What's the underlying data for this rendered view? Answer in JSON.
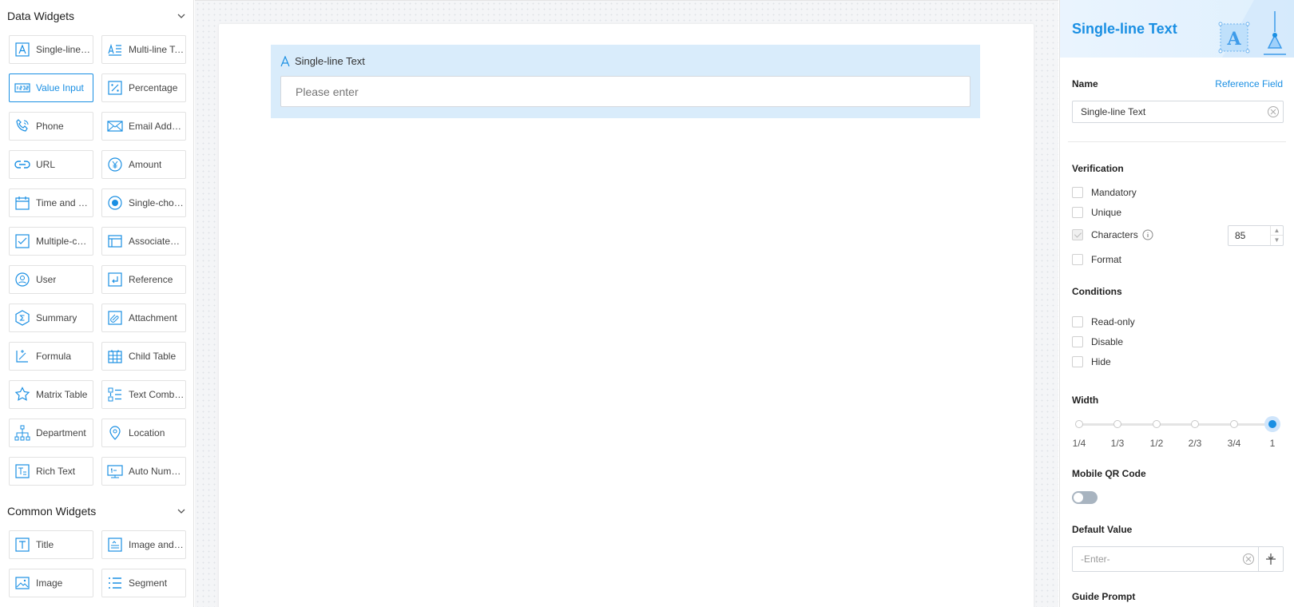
{
  "left_panel": {
    "data_widgets_title": "Data Widgets",
    "data_widgets": [
      {
        "label": "Single-line Text",
        "icon": "text-a-icon"
      },
      {
        "label": "Multi-line Text",
        "icon": "multiline-text-icon"
      },
      {
        "label": "Value Input",
        "icon": "value-input-icon",
        "active": true
      },
      {
        "label": "Percentage",
        "icon": "percentage-icon"
      },
      {
        "label": "Phone",
        "icon": "phone-icon"
      },
      {
        "label": "Email Address",
        "icon": "email-icon"
      },
      {
        "label": "URL",
        "icon": "link-icon"
      },
      {
        "label": "Amount",
        "icon": "amount-icon"
      },
      {
        "label": "Time and Date",
        "icon": "calendar-icon"
      },
      {
        "label": "Single-choice",
        "icon": "radio-icon"
      },
      {
        "label": "Multiple-choice",
        "icon": "checkbox-icon"
      },
      {
        "label": "Associated Form",
        "icon": "associated-form-icon"
      },
      {
        "label": "User",
        "icon": "user-icon"
      },
      {
        "label": "Reference",
        "icon": "reference-icon"
      },
      {
        "label": "Summary",
        "icon": "summary-icon"
      },
      {
        "label": "Attachment",
        "icon": "attachment-icon"
      },
      {
        "label": "Formula",
        "icon": "formula-icon"
      },
      {
        "label": "Child Table",
        "icon": "child-table-icon"
      },
      {
        "label": "Matrix Table",
        "icon": "matrix-table-icon"
      },
      {
        "label": "Text Combination",
        "icon": "text-combination-icon"
      },
      {
        "label": "Department",
        "icon": "department-icon"
      },
      {
        "label": "Location",
        "icon": "location-icon"
      },
      {
        "label": "Rich Text",
        "icon": "rich-text-icon"
      },
      {
        "label": "Auto Number",
        "icon": "auto-number-icon"
      }
    ],
    "common_widgets_title": "Common Widgets",
    "common_widgets": [
      {
        "label": "Title",
        "icon": "title-icon"
      },
      {
        "label": "Image and Text",
        "icon": "image-text-icon"
      },
      {
        "label": "Image",
        "icon": "image-icon"
      },
      {
        "label": "Segment",
        "icon": "segment-icon"
      }
    ]
  },
  "canvas": {
    "field_label": "Single-line Text",
    "field_placeholder": "Please enter"
  },
  "properties": {
    "title": "Single-line Text",
    "name_label": "Name",
    "reference_field": "Reference Field",
    "name_value": "Single-line Text",
    "verification_title": "Verification",
    "mandatory": "Mandatory",
    "unique": "Unique",
    "characters": "Characters",
    "characters_value": "85",
    "format": "Format",
    "conditions_title": "Conditions",
    "read_only": "Read-only",
    "disable": "Disable",
    "hide": "Hide",
    "width_title": "Width",
    "width_options": [
      "1/4",
      "1/3",
      "1/2",
      "2/3",
      "3/4",
      "1"
    ],
    "width_selected": "1",
    "mobile_qr_title": "Mobile QR Code",
    "mobile_qr_enabled": false,
    "default_value_title": "Default Value",
    "default_value_placeholder": "-Enter-",
    "guide_prompt_title": "Guide Prompt"
  },
  "colors": {
    "accent": "#1a8fe3",
    "field_highlight": "#d9ecfb"
  }
}
